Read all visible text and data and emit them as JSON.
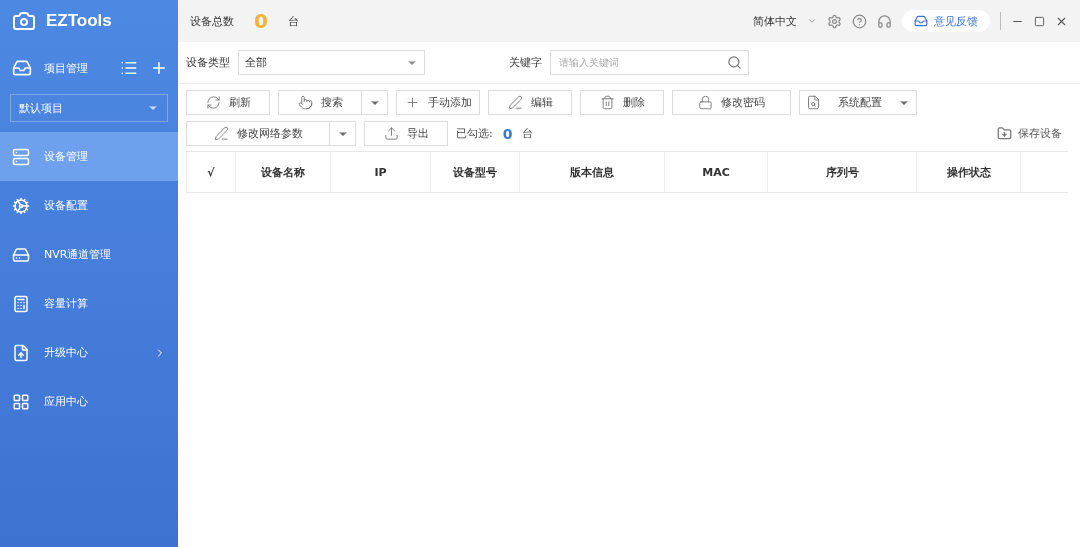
{
  "app": {
    "title": "EZTools"
  },
  "project": {
    "label": "项目管理",
    "value": "默认项目"
  },
  "nav": [
    {
      "label": "设备管理",
      "selected": true,
      "submenu": false
    },
    {
      "label": "设备配置",
      "selected": false,
      "submenu": false
    },
    {
      "label": "NVR通道管理",
      "selected": false,
      "submenu": false
    },
    {
      "label": "容量计算",
      "selected": false,
      "submenu": false
    },
    {
      "label": "升级中心",
      "selected": false,
      "submenu": true
    },
    {
      "label": "应用中心",
      "selected": false,
      "submenu": false
    }
  ],
  "header": {
    "total_label": "设备总数",
    "total_count": "0",
    "total_unit": "台",
    "language": "简体中文",
    "feedback": "意见反馈"
  },
  "filters": {
    "device_type": {
      "label": "设备类型",
      "value": "全部"
    },
    "keyword": {
      "label": "关键字",
      "placeholder": "请输入关键词"
    }
  },
  "toolbar_rows": [
    [
      {
        "label": "刷新",
        "kind": "plain"
      },
      {
        "label": "搜索",
        "kind": "split"
      },
      {
        "label": "手动添加",
        "kind": "plain"
      },
      {
        "label": "编辑",
        "kind": "plain"
      },
      {
        "label": "删除",
        "kind": "plain"
      },
      {
        "label": "修改密码",
        "kind": "plain"
      },
      {
        "label": "系统配置",
        "kind": "menu"
      }
    ],
    [
      {
        "label": "修改网络参数",
        "kind": "split"
      },
      {
        "label": "导出",
        "kind": "plain"
      }
    ]
  ],
  "selection": {
    "label": "已勾选:",
    "count": "0",
    "unit": "台"
  },
  "save_button": "保存设备",
  "table": {
    "columns": [
      "√",
      "设备名称",
      "IP",
      "设备型号",
      "版本信息",
      "MAC",
      "序列号",
      "操作状态"
    ]
  }
}
